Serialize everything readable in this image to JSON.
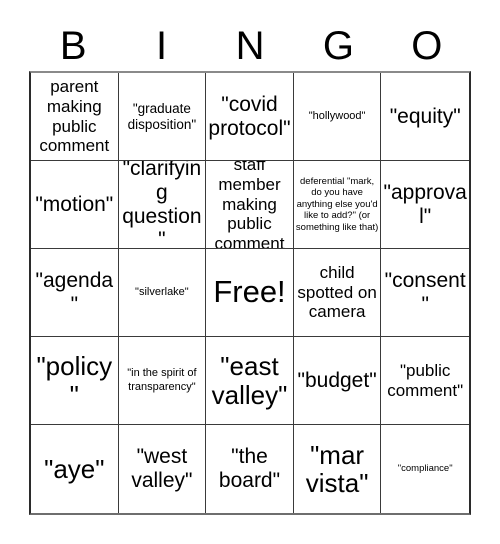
{
  "card": {
    "type": "bingo-card",
    "columns": 5,
    "rows": 5,
    "header": {
      "letters": [
        "B",
        "I",
        "N",
        "G",
        "O"
      ]
    },
    "colors": {
      "background": "#ffffff",
      "text": "#000000",
      "grid_line": "#3a3a3a",
      "outer_border": "#2b2b2b"
    },
    "free_space": {
      "label": "Free!",
      "row": 3,
      "column": 3
    },
    "cells": [
      {
        "text": "parent making public comment",
        "size": "sz-sm",
        "col": "B",
        "row": 1
      },
      {
        "text": "\"graduate disposition\"",
        "size": "sz-xs",
        "col": "I",
        "row": 1
      },
      {
        "text": "\"covid protocol\"",
        "size": "sz-md",
        "col": "N",
        "row": 1
      },
      {
        "text": "\"hollywood\"",
        "size": "sz-xxs",
        "col": "G",
        "row": 1
      },
      {
        "text": "\"equity\"",
        "size": "sz-md",
        "col": "O",
        "row": 1
      },
      {
        "text": "\"motion\"",
        "size": "sz-md",
        "col": "B",
        "row": 2
      },
      {
        "text": "\"clarifying question\"",
        "size": "sz-md",
        "col": "I",
        "row": 2
      },
      {
        "text": "staff member making public comment",
        "size": "sz-sm",
        "col": "N",
        "row": 2
      },
      {
        "text": "deferential \"mark, do you have anything else you'd like to add?\" (or something like that)",
        "size": "sz-tiny",
        "col": "G",
        "row": 2
      },
      {
        "text": "\"approval\"",
        "size": "sz-md",
        "col": "O",
        "row": 2
      },
      {
        "text": "\"agenda\"",
        "size": "sz-md",
        "col": "B",
        "row": 3
      },
      {
        "text": "\"silverlake\"",
        "size": "sz-xxs",
        "col": "I",
        "row": 3
      },
      {
        "text": "Free!",
        "size": "sz-xl",
        "col": "N",
        "row": 3
      },
      {
        "text": "child spotted on camera",
        "size": "sz-sm",
        "col": "G",
        "row": 3
      },
      {
        "text": "\"consent\"",
        "size": "sz-md",
        "col": "O",
        "row": 3
      },
      {
        "text": "\"policy\"",
        "size": "sz-lg",
        "col": "B",
        "row": 4
      },
      {
        "text": "\"in the spirit of transparency\"",
        "size": "sz-xxs",
        "col": "I",
        "row": 4
      },
      {
        "text": "\"east valley\"",
        "size": "sz-lg",
        "col": "N",
        "row": 4
      },
      {
        "text": "\"budget\"",
        "size": "sz-md",
        "col": "G",
        "row": 4
      },
      {
        "text": "\"public comment\"",
        "size": "sz-sm",
        "col": "O",
        "row": 4
      },
      {
        "text": "\"aye\"",
        "size": "sz-lg",
        "col": "B",
        "row": 5
      },
      {
        "text": "\"west valley\"",
        "size": "sz-md",
        "col": "I",
        "row": 5
      },
      {
        "text": "\"the board\"",
        "size": "sz-md",
        "col": "N",
        "row": 5
      },
      {
        "text": "\"mar vista\"",
        "size": "sz-lg",
        "col": "G",
        "row": 5
      },
      {
        "text": "\"compliance\"",
        "size": "sz-tiny",
        "col": "O",
        "row": 5
      }
    ]
  }
}
